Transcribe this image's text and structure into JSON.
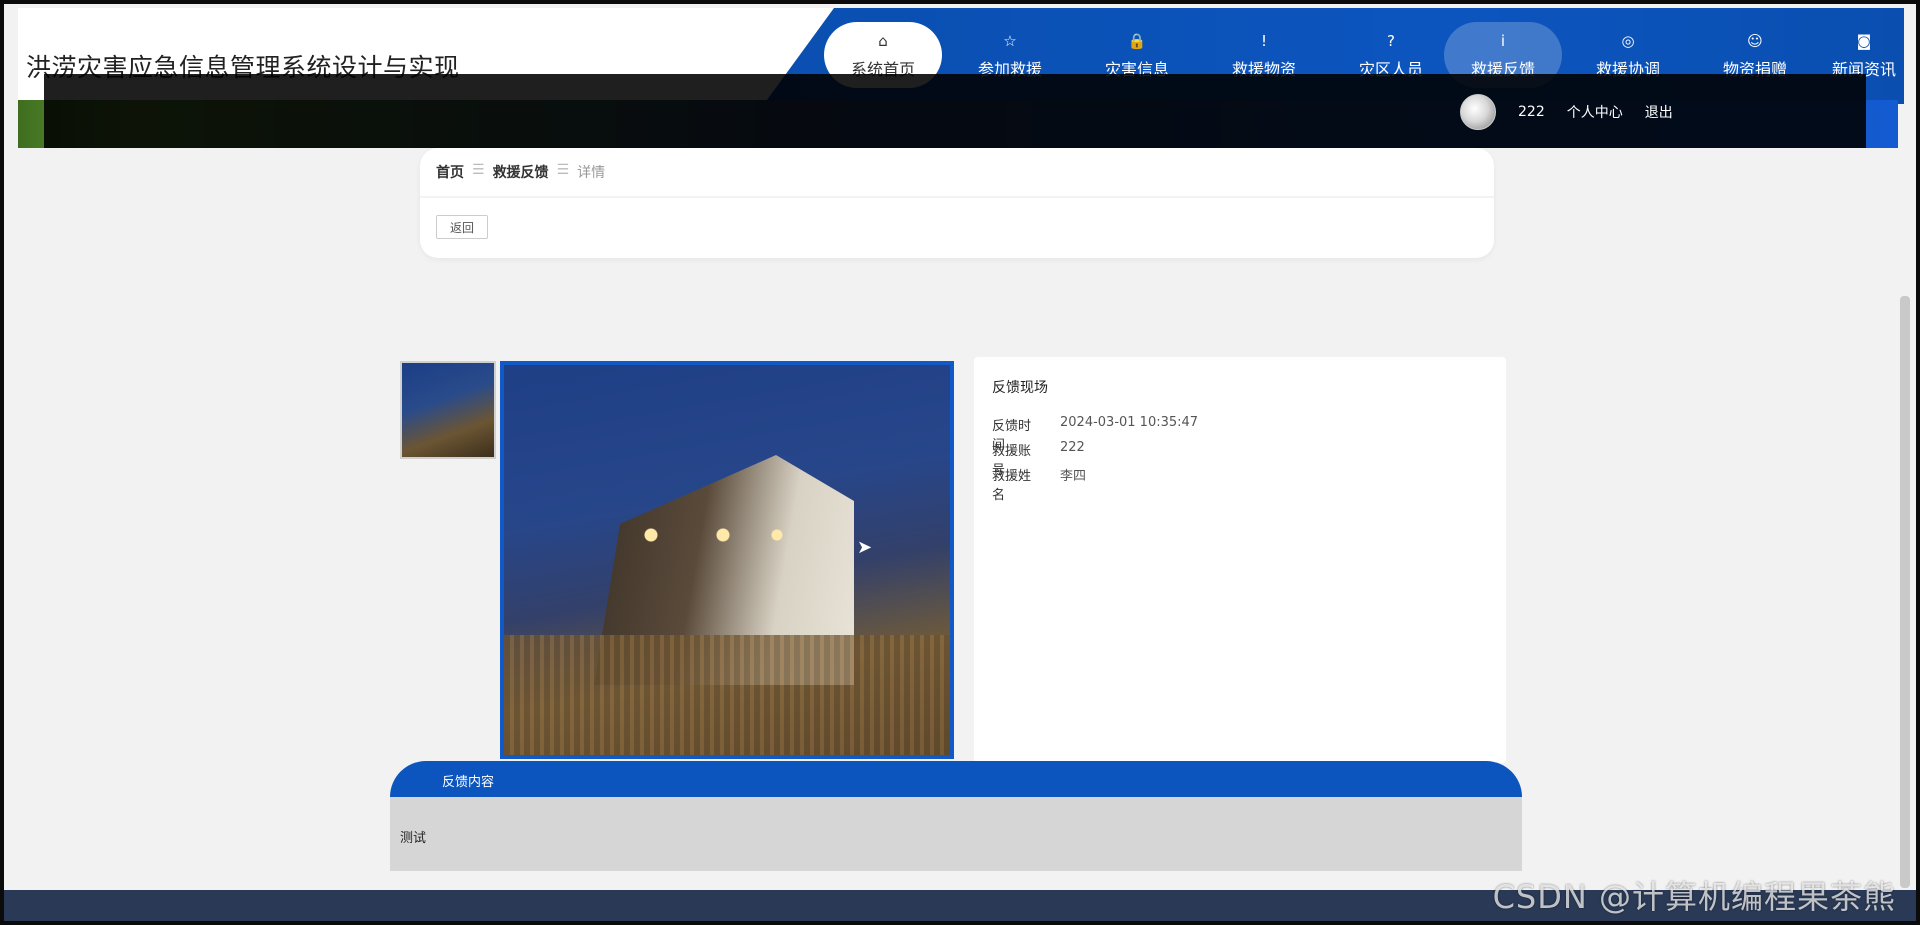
{
  "header": {
    "site_title": "洪涝灾害应急信息管理系统设计与实现"
  },
  "nav": {
    "items": [
      {
        "label": "系统首页",
        "icon": "⌂",
        "icon_name": "home-icon"
      },
      {
        "label": "参加救援",
        "icon": "☆",
        "icon_name": "star-icon"
      },
      {
        "label": "灾害信息",
        "icon": "🔒",
        "icon_name": "lock-icon"
      },
      {
        "label": "救援物资",
        "icon": "!",
        "icon_name": "alert-icon"
      },
      {
        "label": "灾区人员",
        "icon": "?",
        "icon_name": "help-icon"
      },
      {
        "label": "救援反馈",
        "icon": "i",
        "icon_name": "info-icon"
      },
      {
        "label": "救援协调",
        "icon": "◎",
        "icon_name": "coordinate-icon"
      },
      {
        "label": "物资捐赠",
        "icon": "☺",
        "icon_name": "smile-icon"
      },
      {
        "label": "新闻资讯",
        "icon": "◙",
        "icon_name": "camera-icon"
      }
    ]
  },
  "user": {
    "name": "222",
    "profile_label": "个人中心",
    "logout_label": "退出"
  },
  "breadcrumb": {
    "home": "首页",
    "section": "救援反馈",
    "current": "详情",
    "separator": "☰"
  },
  "actions": {
    "back_label": "返回"
  },
  "detail": {
    "title": "反馈现场",
    "fields": [
      {
        "key": "反馈时间",
        "value": "2024-03-01 10:35:47"
      },
      {
        "key": "救援账号",
        "value": "222"
      },
      {
        "key": "救援姓名",
        "value": "李四"
      }
    ]
  },
  "content": {
    "section_title": "反馈内容",
    "text": "测试"
  },
  "watermark": "CSDN @计算机编程果茶熊",
  "colors": {
    "primary": "#0c55bf",
    "footer": "#2a3a56"
  }
}
